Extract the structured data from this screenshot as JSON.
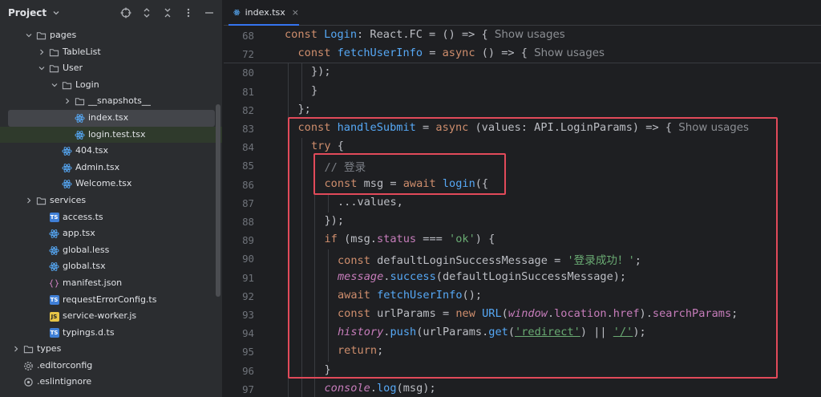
{
  "project": {
    "title": "Project",
    "tree": [
      {
        "label": "pages",
        "type": "folder",
        "depth": 2,
        "expanded": true
      },
      {
        "label": "TableList",
        "type": "folder",
        "depth": 3,
        "expanded": false
      },
      {
        "label": "User",
        "type": "folder",
        "depth": 3,
        "expanded": true
      },
      {
        "label": "Login",
        "type": "folder",
        "depth": 4,
        "expanded": true
      },
      {
        "label": "__snapshots__",
        "type": "folder",
        "depth": 5,
        "expanded": false
      },
      {
        "label": "index.tsx",
        "type": "react",
        "depth": 5,
        "selected": true
      },
      {
        "label": "login.test.tsx",
        "type": "react",
        "depth": 5,
        "hover": true
      },
      {
        "label": "404.tsx",
        "type": "react",
        "depth": 4
      },
      {
        "label": "Admin.tsx",
        "type": "react",
        "depth": 4
      },
      {
        "label": "Welcome.tsx",
        "type": "react",
        "depth": 4
      },
      {
        "label": "services",
        "type": "folder",
        "depth": 2,
        "expanded": false
      },
      {
        "label": "access.ts",
        "type": "ts",
        "depth": 3
      },
      {
        "label": "app.tsx",
        "type": "react",
        "depth": 3
      },
      {
        "label": "global.less",
        "type": "less",
        "depth": 3
      },
      {
        "label": "global.tsx",
        "type": "react",
        "depth": 3
      },
      {
        "label": "manifest.json",
        "type": "json",
        "depth": 3
      },
      {
        "label": "requestErrorConfig.ts",
        "type": "ts",
        "depth": 3
      },
      {
        "label": "service-worker.js",
        "type": "js",
        "depth": 3
      },
      {
        "label": "typings.d.ts",
        "type": "ts",
        "depth": 3
      },
      {
        "label": "types",
        "type": "folder",
        "depth": 1,
        "expanded": false
      },
      {
        "label": ".editorconfig",
        "type": "gear",
        "depth": 1
      },
      {
        "label": ".eslintignore",
        "type": "circle",
        "depth": 1
      }
    ]
  },
  "editor": {
    "tab_label": "index.tsx",
    "tab_close": "×",
    "show_usages": "Show usages",
    "lines": [
      {
        "n": "68",
        "indent": 0,
        "sticky": true,
        "tokens": [
          [
            "kw",
            "const "
          ],
          [
            "fn",
            "Login"
          ],
          [
            "p",
            ": React.FC = () => { "
          ],
          [
            "usage",
            "Show usages"
          ]
        ]
      },
      {
        "n": "72",
        "indent": 1,
        "sticky": true,
        "tokens": [
          [
            "kw",
            "const "
          ],
          [
            "fn",
            "fetchUserInfo"
          ],
          [
            "p",
            " = "
          ],
          [
            "kw",
            "async "
          ],
          [
            "p",
            "() => { "
          ],
          [
            "usage",
            "Show usages"
          ]
        ]
      },
      {
        "n": "80",
        "indent": 2,
        "tokens": [
          [
            "p",
            "});"
          ]
        ]
      },
      {
        "n": "81",
        "indent": 2,
        "tokens": [
          [
            "p",
            "}"
          ]
        ]
      },
      {
        "n": "82",
        "indent": 1,
        "tokens": [
          [
            "p",
            "};"
          ]
        ]
      },
      {
        "n": "83",
        "indent": 1,
        "tokens": [
          [
            "kw",
            "const "
          ],
          [
            "fn",
            "handleSubmit"
          ],
          [
            "p",
            " = "
          ],
          [
            "kw",
            "async "
          ],
          [
            "p",
            "(values: API.LoginParams) => { "
          ],
          [
            "usage",
            "Show usages"
          ]
        ]
      },
      {
        "n": "84",
        "indent": 2,
        "tokens": [
          [
            "kw",
            "try "
          ],
          [
            "p",
            "{"
          ]
        ]
      },
      {
        "n": "85",
        "indent": 3,
        "tokens": [
          [
            "cmt",
            "// 登录"
          ]
        ]
      },
      {
        "n": "86",
        "indent": 3,
        "tokens": [
          [
            "kw",
            "const "
          ],
          [
            "p",
            "msg = "
          ],
          [
            "kw",
            "await "
          ],
          [
            "fn",
            "login"
          ],
          [
            "p",
            "({"
          ]
        ]
      },
      {
        "n": "87",
        "indent": 4,
        "tokens": [
          [
            "p",
            "...values,"
          ]
        ]
      },
      {
        "n": "88",
        "indent": 3,
        "tokens": [
          [
            "p",
            "});"
          ]
        ]
      },
      {
        "n": "89",
        "indent": 3,
        "tokens": [
          [
            "kw",
            "if "
          ],
          [
            "p",
            "(msg."
          ],
          [
            "prop",
            "status"
          ],
          [
            "p",
            " === "
          ],
          [
            "str",
            "'ok'"
          ],
          [
            "p",
            ") {"
          ]
        ]
      },
      {
        "n": "90",
        "indent": 4,
        "tokens": [
          [
            "kw",
            "const "
          ],
          [
            "p",
            "defaultLoginSuccessMessage = "
          ],
          [
            "str",
            "'登录成功！'"
          ],
          [
            "p",
            ";"
          ]
        ]
      },
      {
        "n": "91",
        "indent": 4,
        "tokens": [
          [
            "it",
            "message"
          ],
          [
            "p",
            "."
          ],
          [
            "fn",
            "success"
          ],
          [
            "p",
            "(defaultLoginSuccessMessage);"
          ]
        ]
      },
      {
        "n": "92",
        "indent": 4,
        "tokens": [
          [
            "kw",
            "await "
          ],
          [
            "fn",
            "fetchUserInfo"
          ],
          [
            "p",
            "();"
          ]
        ]
      },
      {
        "n": "93",
        "indent": 4,
        "tokens": [
          [
            "kw",
            "const "
          ],
          [
            "p",
            "urlParams = "
          ],
          [
            "kw",
            "new "
          ],
          [
            "fn",
            "URL"
          ],
          [
            "p",
            "("
          ],
          [
            "it",
            "window"
          ],
          [
            "p",
            "."
          ],
          [
            "prop",
            "location"
          ],
          [
            "p",
            "."
          ],
          [
            "prop",
            "href"
          ],
          [
            "p",
            ")."
          ],
          [
            "prop",
            "searchParams"
          ],
          [
            "p",
            ";"
          ]
        ]
      },
      {
        "n": "94",
        "indent": 4,
        "tokens": [
          [
            "it",
            "history"
          ],
          [
            "p",
            "."
          ],
          [
            "fn",
            "push"
          ],
          [
            "p",
            "(urlParams."
          ],
          [
            "fn",
            "get"
          ],
          [
            "p",
            "("
          ],
          [
            "strul",
            "'redirect'"
          ],
          [
            "p",
            ") || "
          ],
          [
            "strul",
            "'/'"
          ],
          [
            "p",
            ");"
          ]
        ]
      },
      {
        "n": "95",
        "indent": 4,
        "tokens": [
          [
            "kw",
            "return"
          ],
          [
            "p",
            ";"
          ]
        ]
      },
      {
        "n": "96",
        "indent": 3,
        "tokens": [
          [
            "p",
            "}"
          ]
        ]
      },
      {
        "n": "97",
        "indent": 3,
        "tokens": [
          [
            "it",
            "console"
          ],
          [
            "p",
            "."
          ],
          [
            "fn",
            "log"
          ],
          [
            "p",
            "(msg);"
          ]
        ]
      }
    ]
  },
  "colors": {
    "accent": "#3574f0",
    "highlight_box": "#e24a5a",
    "keyword": "#cf8e6d",
    "function": "#56a8f5",
    "string": "#6aab73",
    "comment": "#7a7e85"
  }
}
